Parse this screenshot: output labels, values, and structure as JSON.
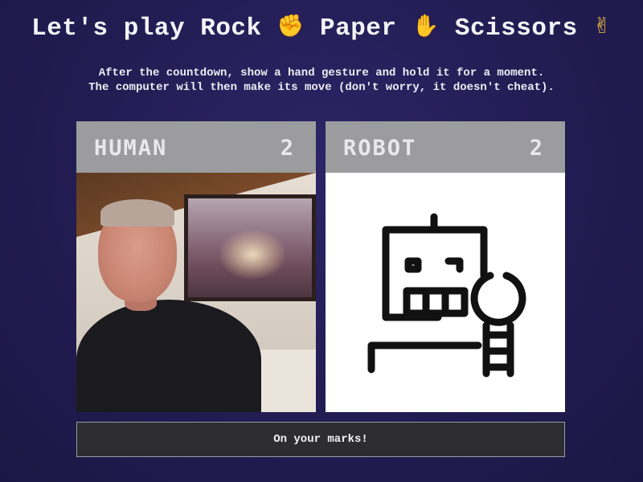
{
  "title": {
    "parts": [
      "Let's play Rock",
      "Paper",
      "Scissors"
    ],
    "emoji": [
      "✊",
      "✋",
      "✌"
    ]
  },
  "instructions": {
    "line1": "After the countdown, show a hand gesture and hold it for a moment.",
    "line2": "The computer will then make its move (don't worry, it doesn't cheat)."
  },
  "panels": {
    "human": {
      "name": "HUMAN",
      "score": "2",
      "view": "webcam-feed"
    },
    "robot": {
      "name": "ROBOT",
      "score": "2",
      "view": "robot-icon"
    }
  },
  "status": {
    "message": "On your marks!"
  },
  "colors": {
    "background": "#231d55",
    "panel_header": "#9c9c9e",
    "status_bg": "#2d2d2f",
    "emoji": "#f7c340"
  }
}
